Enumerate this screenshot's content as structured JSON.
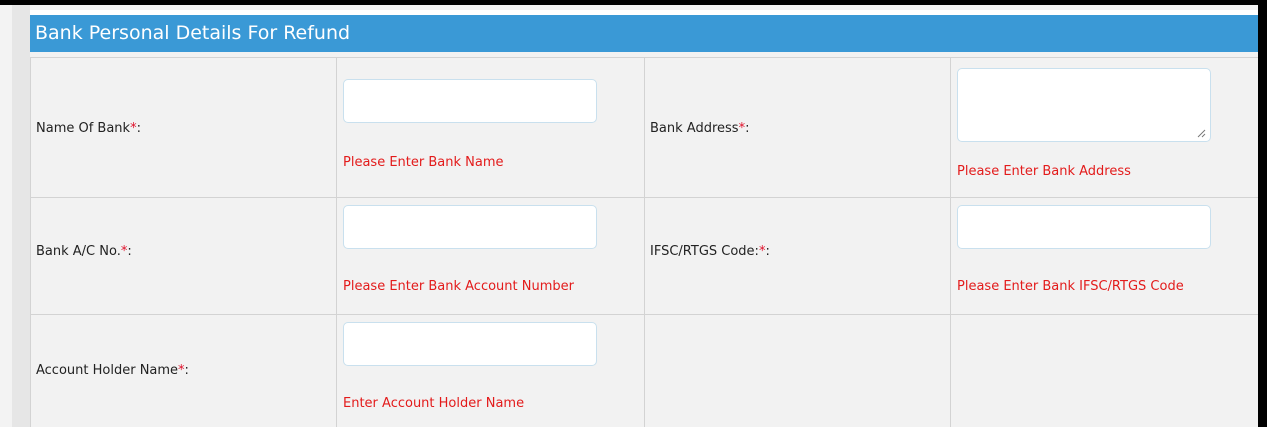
{
  "form": {
    "title": "Bank Personal Details For Refund",
    "rows": [
      {
        "left": {
          "label": "Name Of Bank",
          "required_mark": "*",
          "suffix": ":",
          "value": "",
          "error": "Please Enter Bank Name"
        },
        "right": {
          "label": "Bank Address",
          "required_mark": "*",
          "suffix": ":",
          "value": "",
          "error": "Please Enter Bank Address"
        }
      },
      {
        "left": {
          "label": "Bank A/C No.",
          "required_mark": "*",
          "suffix": ":",
          "value": "",
          "error": "Please Enter Bank Account Number"
        },
        "right": {
          "label": "IFSC/RTGS Code:",
          "required_mark": "*",
          "suffix": ":",
          "value": "",
          "error": "Please Enter Bank IFSC/RTGS Code"
        }
      },
      {
        "left": {
          "label": "Account Holder Name",
          "required_mark": "*",
          "suffix": ":",
          "value": "",
          "error": "Enter Account Holder Name"
        }
      }
    ]
  },
  "colors": {
    "header_bg": "#3a99d6",
    "error_text": "#e31b1b",
    "required_mark": "#e0102a"
  }
}
